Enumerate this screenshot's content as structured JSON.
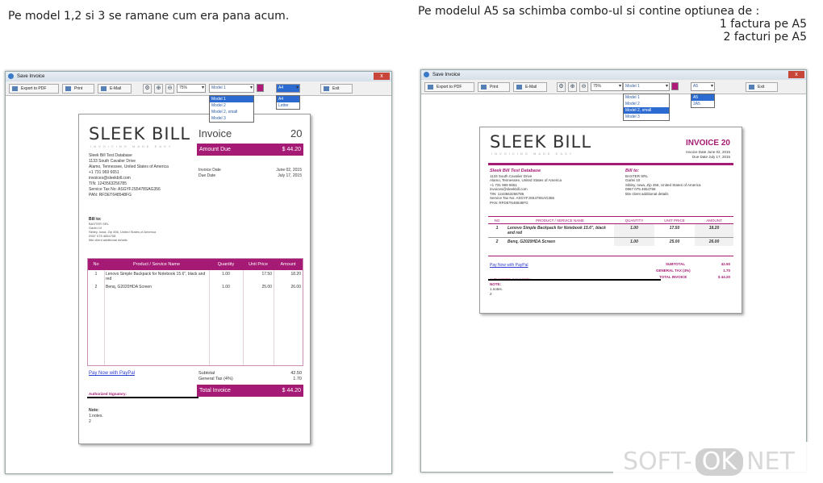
{
  "notes": {
    "left": "Pe model 1,2 si 3 se ramane cum era pana acum.",
    "right_title": "Pe modelul A5 sa schimba combo-ul si contine optiunea de :",
    "right_line1": "1 factura pe A5",
    "right_line2": "2 facturi  pe A5"
  },
  "window": {
    "title": "Save Invoice",
    "close": "x"
  },
  "toolbar": {
    "export": "Export to PDF",
    "print": "Print",
    "email": "E-Mail",
    "exit": "Exit",
    "zoom": "75%",
    "model": "Model 1",
    "color": "#b0197a"
  },
  "left": {
    "paper_selected": "A4",
    "paper_options": [
      "A4",
      "Letter"
    ],
    "model_options": [
      "Model 1",
      "Model 2",
      "Model 2, small",
      "Model 3"
    ]
  },
  "right": {
    "paper_selected": "A5",
    "paper_options": [
      "A5",
      "2A5"
    ],
    "model_options": [
      "Model 1",
      "Model 2",
      "Model 2, small",
      "Model 3"
    ]
  },
  "invoice": {
    "logo": "SLEEK BILL",
    "tagline": "INVOICING MADE EASY",
    "title": "Invoice",
    "number": "20",
    "title_upper": "INVOICE 20",
    "amount_due_label": "Amount Due",
    "amount_due": "$ 44.20",
    "date_label": "Invoice Date",
    "date": "June 02, 2015",
    "due_label": "Due Date",
    "due": "July 17, 2015",
    "date_line": "Invoice Date June 02, 2015",
    "due_line": "Due Date July 17, 2015",
    "company": "Sleek Bill Test Database",
    "address1": "1133 South Cavalier Drive",
    "address2": "Alamo, Tennessee, United States of America",
    "phone": "+1 731 969 6651",
    "email": "invoices@sleekbill.com",
    "tin": "TIN: 1243563256785",
    "stax": "Service Tax No: ASGYFJS5478SAG356",
    "pan": "PAN: RFDET648548FG",
    "billto_label": "Bill to:",
    "client": "BASTER SRL",
    "client_addr1": "Garlei 10",
    "client_addr2": "Sibley, Iowa, Zip 456, United States of America",
    "client_phone": "0967 075 4654758",
    "client_details": "title client additional details",
    "headers": [
      "No",
      "Product / Service Name",
      "Quantity",
      "Unit Price",
      "Amount"
    ],
    "headers_upper": [
      "NO",
      "PRODUCT / SERVICE NAME",
      "QUANTITY",
      "UNIT PRICE",
      "AMOUNT"
    ],
    "items": [
      {
        "no": "1",
        "name": "Lenovo Simple Backpack for Notebook 15.6\", black and red",
        "qty": "1.00",
        "price": "17.50",
        "amount": "18.20"
      },
      {
        "no": "2",
        "name": "Benq, G2020HDA Screen",
        "qty": "1.00",
        "price": "25.00",
        "amount": "26.00"
      }
    ],
    "paypal": "Pay Now with PayPal",
    "subtotal_label": "Subtotal",
    "subtotal": "42.50",
    "tax_label": "General Tax (4%)",
    "tax": "1.70",
    "total_label": "Total Invoice",
    "total": "$ 44.20",
    "subtotal_upper": "SUBTOTAL",
    "tax_upper": "GENERAL TAX (4%)",
    "total_upper": "TOTAL INVOICE",
    "signatory": "Authorized Signatory:",
    "signatory_upper": "AUTHORIZED SIGNATORY:",
    "note_label": "Note:",
    "note_upper": "NOTE:",
    "notes": "1.notes.",
    "notes2": "2"
  },
  "watermark": {
    "a": "SOFT-",
    "b": "OK",
    ".": ".",
    "c": "NET"
  }
}
